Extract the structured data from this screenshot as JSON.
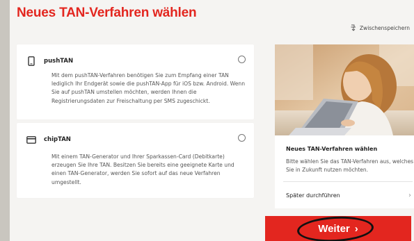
{
  "page": {
    "title": "Neues TAN-Verfahren wählen",
    "save_link": "Zwischenspeichern"
  },
  "options": [
    {
      "name": "pushTAN",
      "text": "Mit dem pushTAN-Verfahren benötigen Sie zum Empfang einer TAN lediglich Ihr Endgerät sowie die pushTAN-App für iOS bzw. Android. Wenn Sie auf pushTAN umstellen möchten, werden Ihnen die Registrierungsdaten zur Freischaltung per SMS zugeschickt.",
      "icon": "smartphone-icon",
      "selected": false
    },
    {
      "name": "chipTAN",
      "text": "Mit einem TAN-Generator und Ihrer Sparkassen-Card (Debitkarte) erzeugen Sie Ihre TAN. Besitzen Sie bereits eine geeignete Karte und einen TAN-Generator, werden Sie sofort auf das neue Verfahren umgestellt.",
      "icon": "card-icon",
      "selected": false
    }
  ],
  "side": {
    "title": "Neues TAN-Verfahren wählen",
    "text": "Bitte wählen Sie das TAN-Verfahren aus, welches Sie in Zukunft nutzen möchten.",
    "later_label": "Später durchführen",
    "later_chevron": "›"
  },
  "actions": {
    "weiter_label": "Weiter",
    "weiter_chevron": "›"
  },
  "colors": {
    "accent": "#e3261f",
    "background": "#f5f4f2"
  }
}
